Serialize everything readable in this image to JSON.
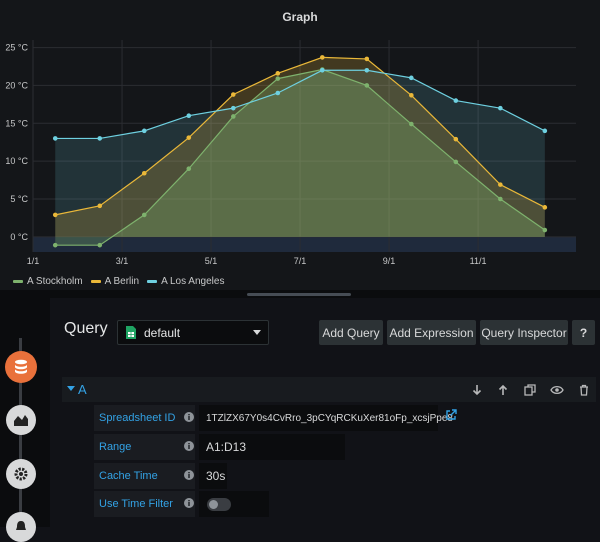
{
  "panel": {
    "title": "Graph"
  },
  "chart_data": {
    "type": "area",
    "title": "Graph",
    "unit": "°C",
    "ylim": [
      -2,
      26
    ],
    "yticks": [
      "0 °C",
      "5 °C",
      "10 °C",
      "15 °C",
      "20 °C",
      "25 °C"
    ],
    "yticks_values": [
      0,
      5,
      10,
      15,
      20,
      25
    ],
    "xticks": [
      "1/1",
      "3/1",
      "5/1",
      "7/1",
      "9/1",
      "11/1"
    ],
    "xticks_values": [
      1,
      3,
      5,
      7,
      9,
      11
    ],
    "x": [
      1.5,
      2.5,
      3.5,
      4.5,
      5.5,
      6.5,
      7.5,
      8.5,
      9.5,
      10.5,
      11.5,
      12.5
    ],
    "xlim": [
      1,
      13.2
    ],
    "grid": true,
    "legend_position": "bottom-left",
    "series": [
      {
        "name": "A Stockholm",
        "color": "#7eb26d",
        "values": [
          -1.1,
          -1.1,
          2.9,
          9.0,
          15.9,
          20.9,
          22.1,
          20.0,
          14.9,
          9.9,
          5.0,
          0.9
        ]
      },
      {
        "name": "A Berlin",
        "color": "#eab839",
        "values": [
          2.9,
          4.1,
          8.4,
          13.1,
          18.8,
          21.6,
          23.7,
          23.5,
          18.7,
          12.9,
          6.9,
          3.9
        ]
      },
      {
        "name": "A Los Angeles",
        "color": "#6ed0e0",
        "values": [
          13.0,
          13.0,
          14.0,
          16.0,
          17.0,
          19.0,
          22.0,
          22.0,
          21.0,
          18.0,
          17.0,
          14.0
        ]
      }
    ]
  },
  "query_editor": {
    "header": "Query",
    "datasource": "default",
    "buttons": {
      "add_query": "Add Query",
      "add_expression": "Add Expression",
      "query_inspector": "Query Inspector",
      "help": "?"
    },
    "query": {
      "ref_id": "A",
      "fields": {
        "spreadsheet_id_label": "Spreadsheet ID",
        "spreadsheet_id_value": "1TZlZX67Y0s4CvRro_3pCYqRCKuXer81oFp_xcsjPpe8",
        "range_label": "Range",
        "range_value": "A1:D13",
        "cache_time_label": "Cache Time",
        "cache_time_value": "30s",
        "time_filter_label": "Use Time Filter",
        "time_filter_enabled": false
      }
    }
  }
}
